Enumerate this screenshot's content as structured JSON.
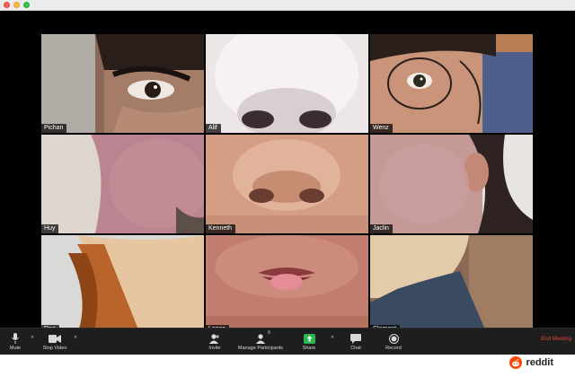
{
  "window": {
    "controls": [
      "close",
      "minimize",
      "maximize"
    ]
  },
  "participants": [
    {
      "name": "Pichan",
      "skin": "#b08b78",
      "feature": "eye"
    },
    {
      "name": "Alif",
      "skin": "#e7dfdf",
      "feature": "nose-light"
    },
    {
      "name": "Wenz",
      "skin": "#d6a48d",
      "feature": "glasses-eye"
    },
    {
      "name": "Huy",
      "skin": "#b8828a",
      "feature": "cheek"
    },
    {
      "name": "Kenneth",
      "skin": "#d49d84",
      "feature": "nose"
    },
    {
      "name": "Jaclin",
      "skin": "#c79c96",
      "feature": "ear"
    },
    {
      "name": "Rae",
      "skin": "#c79a77",
      "feature": "chin-hair"
    },
    {
      "name": "Lance",
      "skin": "#c07c6e",
      "feature": "lips"
    },
    {
      "name": "Clement",
      "skin": "#e0c8a8",
      "feature": "neck"
    }
  ],
  "toolbar": {
    "mute": "Mute",
    "stop_video": "Stop Video",
    "invite": "Invite",
    "manage_participants": "Manage Participants",
    "participant_count": "9",
    "share": "Share",
    "chat": "Chat",
    "record": "Record",
    "end_meeting": "End Meeting"
  },
  "footer": {
    "brand": "reddit"
  },
  "colors": {
    "toolbar_bg": "#1e1e1e",
    "share_green": "#2bb74e",
    "end_red": "#e0473c",
    "reddit_orange": "#ff4500"
  }
}
